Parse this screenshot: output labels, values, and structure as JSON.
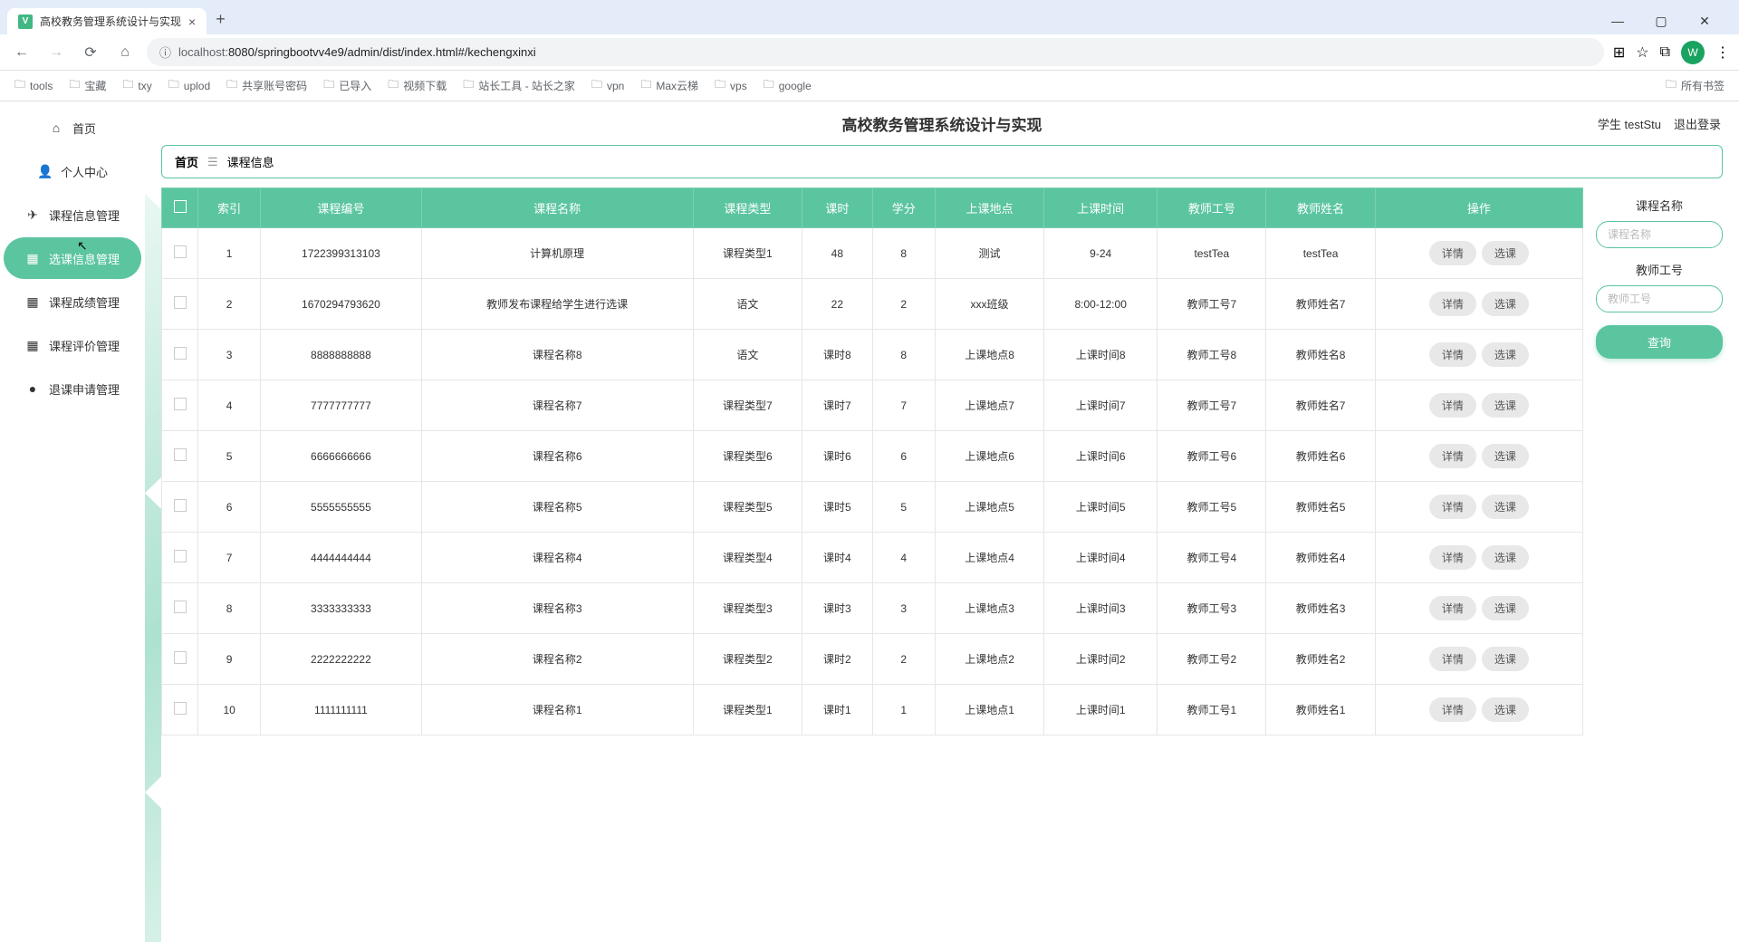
{
  "browser": {
    "tab_title": "高校教务管理系统设计与实现",
    "url_prefix": "localhost:",
    "url": "8080/springbootvv4e9/admin/dist/index.html#/kechengxinxi",
    "avatar_letter": "W",
    "bookmarks": [
      "tools",
      "宝藏",
      "txy",
      "uplod",
      "共享账号密码",
      "已导入",
      "视频下载",
      "站长工具 - 站长之家",
      "vpn",
      "Max云梯",
      "vps",
      "google"
    ],
    "bookmark_right": "所有书签"
  },
  "app": {
    "title": "高校教务管理系统设计与实现",
    "user_label": "学生 testStu",
    "logout": "退出登录",
    "breadcrumb_home": "首页",
    "breadcrumb_current": "课程信息",
    "sidebar": [
      {
        "icon": "⌂",
        "label": "首页"
      },
      {
        "icon": "👤",
        "label": "个人中心"
      },
      {
        "icon": "✈",
        "label": "课程信息管理"
      },
      {
        "icon": "▦",
        "label": "选课信息管理",
        "active": true
      },
      {
        "icon": "▦",
        "label": "课程成绩管理"
      },
      {
        "icon": "▦",
        "label": "课程评价管理"
      },
      {
        "icon": "●",
        "label": "退课申请管理"
      }
    ],
    "columns": [
      "",
      "索引",
      "课程编号",
      "课程名称",
      "课程类型",
      "课时",
      "学分",
      "上课地点",
      "上课时间",
      "教师工号",
      "教师姓名",
      "操作"
    ],
    "rows": [
      {
        "idx": "1",
        "no": "1722399313103",
        "name": "计算机原理",
        "type": "课程类型1",
        "hours": "48",
        "credit": "8",
        "place": "测试",
        "time": "9-24",
        "tno": "testTea",
        "tname": "testTea"
      },
      {
        "idx": "2",
        "no": "1670294793620",
        "name": "教师发布课程给学生进行选课",
        "type": "语文",
        "hours": "22",
        "credit": "2",
        "place": "xxx班级",
        "time": "8:00-12:00",
        "tno": "教师工号7",
        "tname": "教师姓名7"
      },
      {
        "idx": "3",
        "no": "8888888888",
        "name": "课程名称8",
        "type": "语文",
        "hours": "课时8",
        "credit": "8",
        "place": "上课地点8",
        "time": "上课时间8",
        "tno": "教师工号8",
        "tname": "教师姓名8"
      },
      {
        "idx": "4",
        "no": "7777777777",
        "name": "课程名称7",
        "type": "课程类型7",
        "hours": "课时7",
        "credit": "7",
        "place": "上课地点7",
        "time": "上课时间7",
        "tno": "教师工号7",
        "tname": "教师姓名7"
      },
      {
        "idx": "5",
        "no": "6666666666",
        "name": "课程名称6",
        "type": "课程类型6",
        "hours": "课时6",
        "credit": "6",
        "place": "上课地点6",
        "time": "上课时间6",
        "tno": "教师工号6",
        "tname": "教师姓名6"
      },
      {
        "idx": "6",
        "no": "5555555555",
        "name": "课程名称5",
        "type": "课程类型5",
        "hours": "课时5",
        "credit": "5",
        "place": "上课地点5",
        "time": "上课时间5",
        "tno": "教师工号5",
        "tname": "教师姓名5"
      },
      {
        "idx": "7",
        "no": "4444444444",
        "name": "课程名称4",
        "type": "课程类型4",
        "hours": "课时4",
        "credit": "4",
        "place": "上课地点4",
        "time": "上课时间4",
        "tno": "教师工号4",
        "tname": "教师姓名4"
      },
      {
        "idx": "8",
        "no": "3333333333",
        "name": "课程名称3",
        "type": "课程类型3",
        "hours": "课时3",
        "credit": "3",
        "place": "上课地点3",
        "time": "上课时间3",
        "tno": "教师工号3",
        "tname": "教师姓名3"
      },
      {
        "idx": "9",
        "no": "2222222222",
        "name": "课程名称2",
        "type": "课程类型2",
        "hours": "课时2",
        "credit": "2",
        "place": "上课地点2",
        "time": "上课时间2",
        "tno": "教师工号2",
        "tname": "教师姓名2"
      },
      {
        "idx": "10",
        "no": "1111111111",
        "name": "课程名称1",
        "type": "课程类型1",
        "hours": "课时1",
        "credit": "1",
        "place": "上课地点1",
        "time": "上课时间1",
        "tno": "教师工号1",
        "tname": "教师姓名1"
      }
    ],
    "action_detail": "详情",
    "action_select": "选课",
    "filter": {
      "label_name": "课程名称",
      "ph_name": "课程名称",
      "label_tno": "教师工号",
      "ph_tno": "教师工号",
      "query": "查询"
    }
  }
}
